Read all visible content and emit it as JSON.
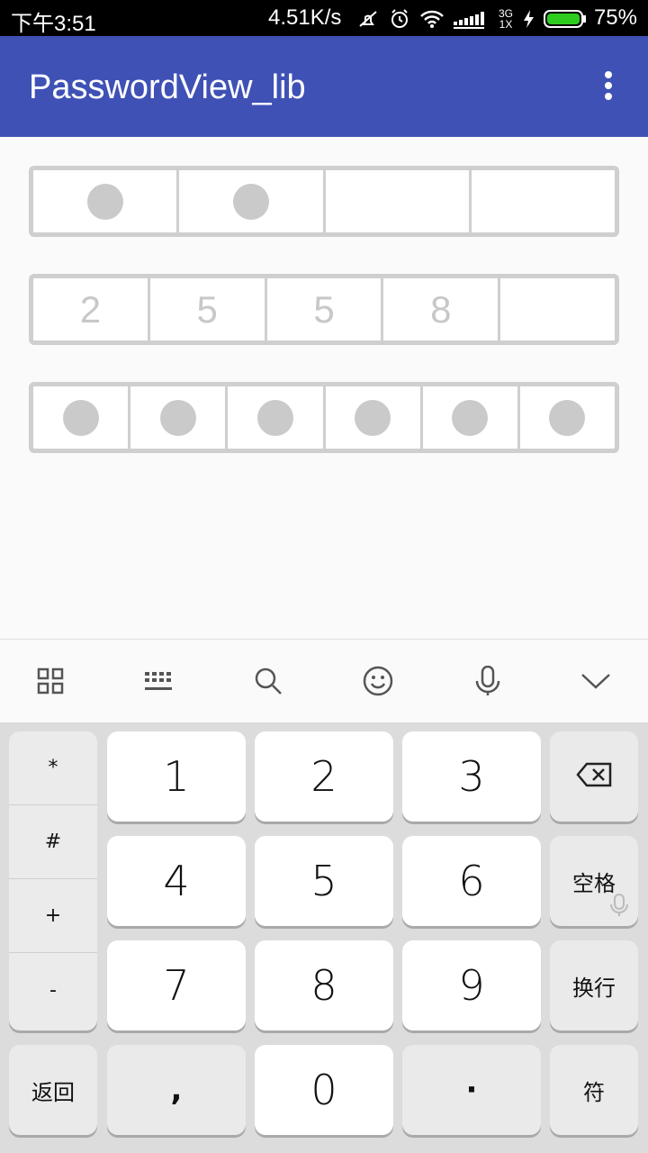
{
  "status_bar": {
    "time": "下午3:51",
    "net_speed": "4.51K/s",
    "net_type_top": "3G",
    "net_type_bottom": "1X",
    "battery_percent": "75%",
    "icons": [
      "mute-vibrate-icon",
      "alarm-icon",
      "wifi-icon",
      "signal-icon",
      "charging-icon",
      "battery-icon"
    ]
  },
  "app_bar": {
    "title": "PasswordView_lib",
    "overflow_icon": "more-vert-icon",
    "color": "#3f51b5"
  },
  "password_views": [
    {
      "cells": 4,
      "style": "dots",
      "filled": 2
    },
    {
      "cells": 5,
      "style": "digits",
      "values": [
        "2",
        "5",
        "5",
        "8",
        ""
      ]
    },
    {
      "cells": 6,
      "style": "dots",
      "filled": 6
    }
  ],
  "keyboard_toolbar": {
    "icons": [
      "grid-menu-icon",
      "keyboard-icon",
      "search-icon",
      "emoji-icon",
      "microphone-icon",
      "chevron-down-icon"
    ]
  },
  "keyboard": {
    "symbols": [
      "*",
      "#",
      "+",
      "-"
    ],
    "digits": [
      "1",
      "2",
      "3",
      "4",
      "5",
      "6",
      "7",
      "8",
      "9"
    ],
    "backspace_icon": "backspace-icon",
    "space_label": "空格",
    "enter_label": "换行",
    "back_label": "返回",
    "comma": ",",
    "zero": "0",
    "dot": "·",
    "symbol_label": "符"
  }
}
